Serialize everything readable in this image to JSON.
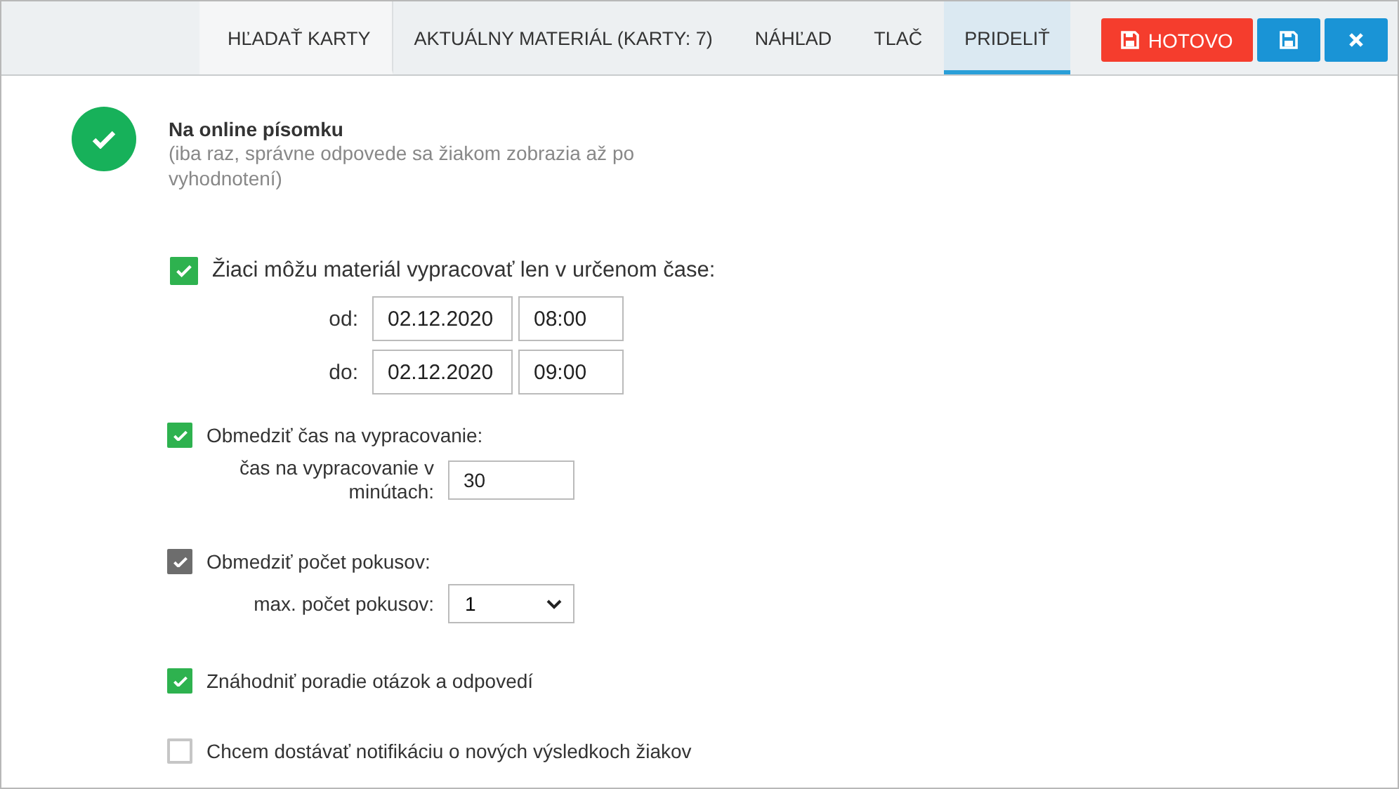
{
  "tabs": [
    {
      "label": "HĽADAŤ KARTY",
      "selected": false,
      "kind": "light"
    },
    {
      "label": "AKTUÁLNY MATERIÁL (KARTY: 7)",
      "selected": false,
      "kind": "normal"
    },
    {
      "label": "NÁHĽAD",
      "selected": false,
      "kind": "normal"
    },
    {
      "label": "TLAČ",
      "selected": false,
      "kind": "normal"
    },
    {
      "label": "PRIDELIŤ",
      "selected": true,
      "kind": "normal"
    }
  ],
  "buttons": [
    {
      "kind": "done",
      "label": "HOTOVO"
    },
    {
      "kind": "save"
    },
    {
      "kind": "close"
    }
  ],
  "mode": {
    "title": "Na online písomku",
    "subtitle": "(iba raz, správne odpovede sa žiakom zobrazia až po vyhodnotení)"
  },
  "options": [
    {
      "kind": "time_window",
      "label": "Žiaci môžu materiál vypracovať len v určenom čase:",
      "checked": true,
      "disabled": false,
      "rows": [
        {
          "label": "od:",
          "date": "02.12.2020",
          "time": "08:00"
        },
        {
          "label": "do:",
          "date": "02.12.2020",
          "time": "09:00"
        }
      ]
    },
    {
      "kind": "field",
      "label": "Obmedziť čas na vypracovanie:",
      "checked": true,
      "disabled": false,
      "field_label": "čas na vypracovanie v minútach:",
      "value": "30"
    },
    {
      "kind": "select",
      "label": "Obmedziť počet pokusov:",
      "checked": true,
      "disabled": true,
      "field_label": "max. počet pokusov:",
      "value": "1"
    },
    {
      "kind": "plain",
      "label": "Znáhodniť poradie otázok a odpovedí",
      "checked": true,
      "disabled": false
    },
    {
      "kind": "plain",
      "label": "Chcem dostávať notifikáciu o nových výsledkoch žiakov",
      "checked": false,
      "disabled": false
    }
  ]
}
